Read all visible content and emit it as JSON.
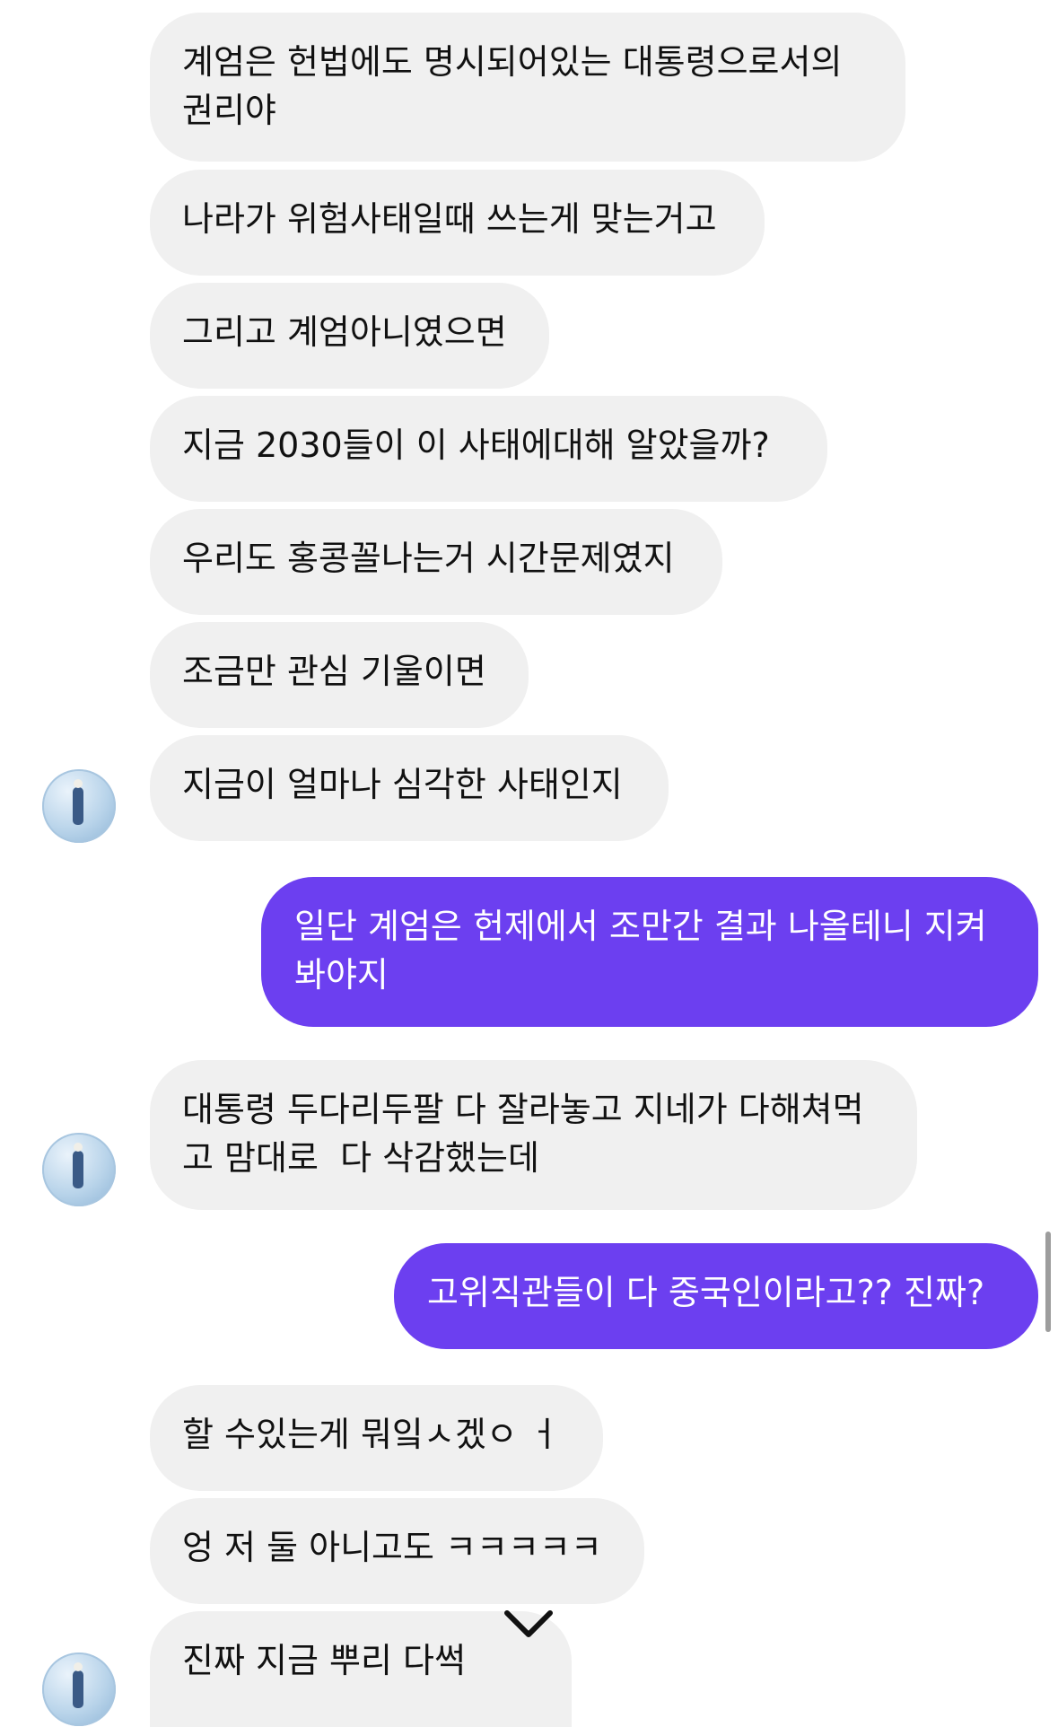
{
  "messages": [
    {
      "text": "계엄은 헌법에도 명시되어있는 대통령으로서의\n권리야"
    },
    {
      "text": "나라가 위험사태일때 쓰는게 맞는거고"
    },
    {
      "text": "그리고 계엄아니였으면"
    },
    {
      "text": "지금 2030들이 이 사태에대해 알았을까?"
    },
    {
      "text": "우리도 홍콩꼴나는거 시간문제였지"
    },
    {
      "text": "조금만 관심 기울이면"
    },
    {
      "text": "지금이 얼마나 심각한 사태인지"
    },
    {
      "text": "일단 계엄은 헌제에서 조만간 결과 나올테니 지켜\n봐야지"
    },
    {
      "text": "대통령 두다리두팔 다 잘라놓고 지네가 다해쳐먹\n고 맘대로  다 삭감했는데"
    },
    {
      "text": "고위직관들이 다 중국인이라고?? 진짜?"
    },
    {
      "text": "할 수있는게 뭐잌ㅅ겠ㅇ ㅓ"
    },
    {
      "text": "엉 저 둘 아니고도 ㅋㅋㅋㅋㅋ"
    },
    {
      "text": "진짜 지금 뿌리 다썩"
    }
  ],
  "colors": {
    "received_bubble": "#f0f0f0",
    "sent_bubble": "#6c3ff0",
    "text_dark": "#111111",
    "text_light": "#ffffff"
  },
  "icons": {
    "scroll_down": "chevron-down-icon",
    "avatar": "avatar"
  }
}
